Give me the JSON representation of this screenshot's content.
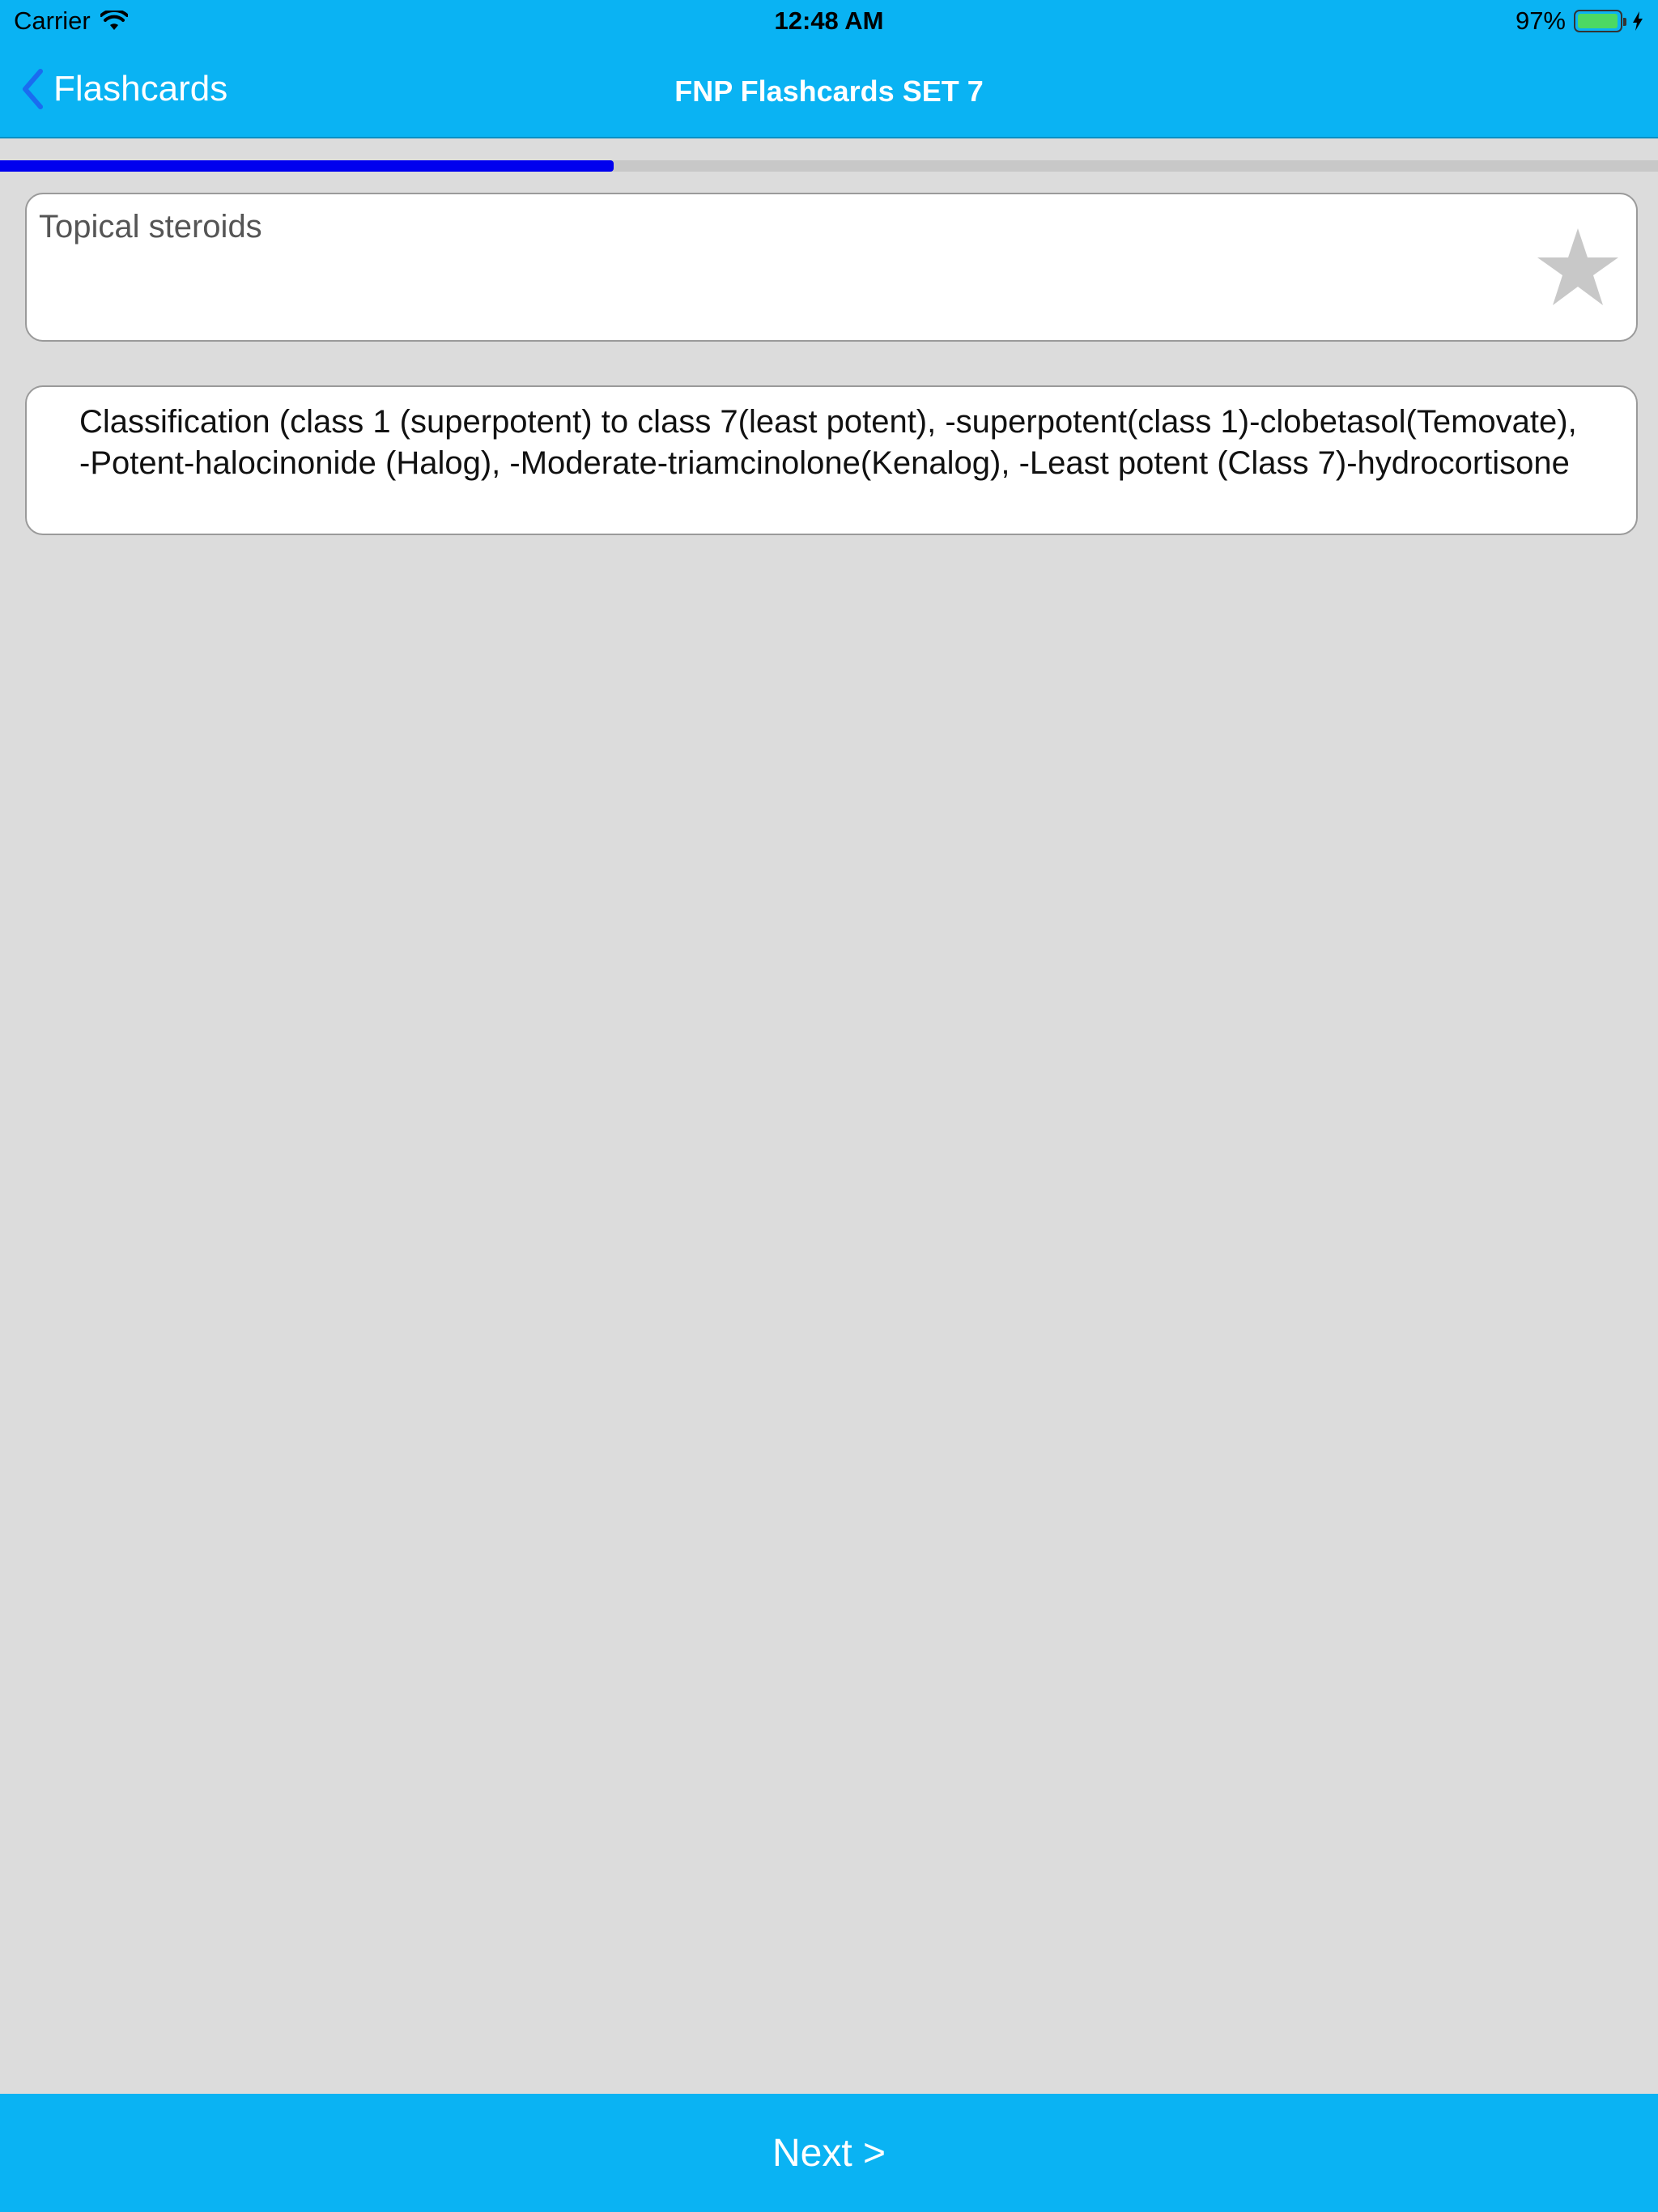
{
  "status_bar": {
    "carrier": "Carrier",
    "time": "12:48 AM",
    "battery": "97%",
    "battery_level": 0.97
  },
  "nav": {
    "back_label": "Flashcards",
    "title": "FNP Flashcards SET 7"
  },
  "progress": {
    "fraction": 0.37
  },
  "card": {
    "question": "Topical steroids",
    "answer": "Classification (class 1 (superpotent) to class 7(least potent), -superpotent(class 1)-clobetasol(Temovate), -Potent-halocinonide (Halog), -Moderate-triamcinolone(Kenalog), -Least potent (Class 7)-hydrocortisone"
  },
  "footer": {
    "next_label": "Next >"
  },
  "colors": {
    "bar": "#0ab3f3",
    "progress": "#0000ee",
    "background": "#dcdcdc",
    "star": "#c8c8c8"
  },
  "icons": {
    "wifi": "wifi-icon",
    "battery": "battery-icon",
    "charging": "bolt-icon",
    "back": "chevron-left-icon",
    "favorite": "star-icon"
  }
}
